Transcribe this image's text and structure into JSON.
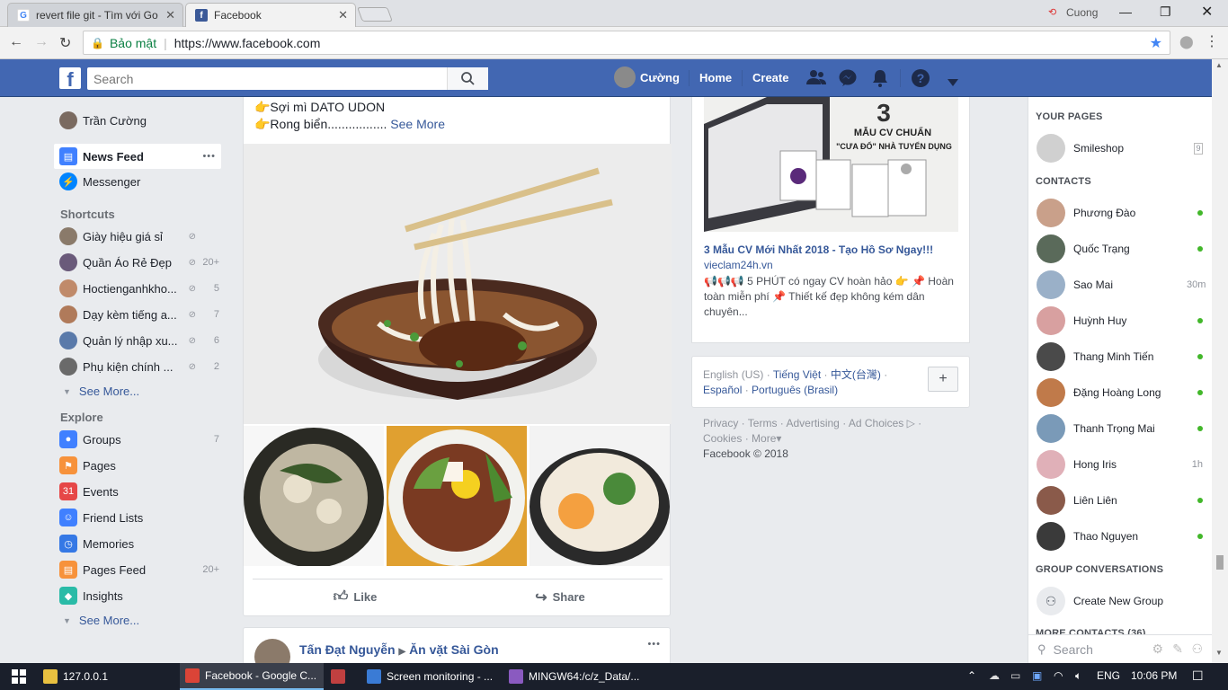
{
  "browser": {
    "tabs": [
      {
        "title": "revert file git - Tìm với Go",
        "icon": "google-icon"
      },
      {
        "title": "Facebook",
        "icon": "facebook-icon"
      }
    ],
    "profile_name": "Cuong",
    "secure_label": "Bảo mật",
    "url": "https://www.facebook.com"
  },
  "fb_header": {
    "search_placeholder": "Search",
    "user_name": "Cường",
    "home": "Home",
    "create": "Create"
  },
  "left_nav": {
    "profile": "Trần Cường",
    "main": [
      {
        "label": "News Feed",
        "icon": "news-feed-icon"
      },
      {
        "label": "Messenger",
        "icon": "messenger-icon"
      }
    ],
    "more_dots": "•••",
    "shortcuts_title": "Shortcuts",
    "shortcuts": [
      {
        "label": "Giày hiệu giá sỉ",
        "count": ""
      },
      {
        "label": "Quần Áo Rẻ Đẹp",
        "count": "20+"
      },
      {
        "label": "Hoctienganhkho...",
        "count": "5"
      },
      {
        "label": "Dạy kèm tiếng a...",
        "count": "7"
      },
      {
        "label": "Quản lý nhập xu...",
        "count": "6"
      },
      {
        "label": "Phụ kiện chính ...",
        "count": "2"
      }
    ],
    "see_more": "See More...",
    "explore_title": "Explore",
    "explore": [
      {
        "label": "Groups",
        "count": "7",
        "icon": "groups-icon",
        "color": "#4080ff"
      },
      {
        "label": "Pages",
        "count": "",
        "icon": "pages-flag-icon",
        "color": "#f7923b"
      },
      {
        "label": "Events",
        "count": "",
        "icon": "events-calendar-icon",
        "color": "#e64747"
      },
      {
        "label": "Friend Lists",
        "count": "",
        "icon": "friend-lists-icon",
        "color": "#4080ff"
      },
      {
        "label": "Memories",
        "count": "",
        "icon": "memories-clock-icon",
        "color": "#3578e5"
      },
      {
        "label": "Pages Feed",
        "count": "20+",
        "icon": "pages-feed-icon",
        "color": "#f7923b"
      },
      {
        "label": "Insights",
        "count": "",
        "icon": "insights-cube-icon",
        "color": "#2abba7"
      }
    ],
    "see_more_2": "See More..."
  },
  "post": {
    "line1": "👉Sợi mì DATO UDON",
    "line2": "👉Rong biển.................",
    "see_more": "See More",
    "like": "Like",
    "share": "Share"
  },
  "post2": {
    "author": "Tấn Đạt Nguyễn",
    "group": "Ăn vặt Sài Gòn",
    "options": "•••"
  },
  "ad": {
    "image_text_1": "3",
    "image_text_2": "MẪU CV CHUẨN",
    "image_text_3": "\"CƯA ĐỔ\" NHÀ TUYỂN DỤNG",
    "title": "3 Mẫu CV Mới Nhất 2018 - Tạo Hồ Sơ Ngay!!!",
    "domain": "vieclam24h.vn",
    "body": "📢📢📢 5 PHÚT có ngay CV hoàn hảo 👉 📌 Hoàn toàn miễn phí 📌 Thiết kế đẹp không kém dân chuyên..."
  },
  "languages": {
    "current": "English (US)",
    "others": [
      "Tiếng Việt",
      "中文(台灣)",
      "Español",
      "Português (Brasil)"
    ],
    "plus": "+"
  },
  "footer": {
    "links": [
      "Privacy",
      "Terms",
      "Advertising",
      "Ad Choices",
      "Cookies",
      "More"
    ],
    "copyright": "Facebook © 2018"
  },
  "chat": {
    "your_pages_title": "YOUR PAGES",
    "page": {
      "name": "Smileshop",
      "badge": "9"
    },
    "contacts_title": "CONTACTS",
    "contacts": [
      {
        "name": "Phương Đào",
        "status": "online",
        "color": "#c9a08a"
      },
      {
        "name": "Quốc Trạng",
        "status": "online",
        "color": "#5a6a5a"
      },
      {
        "name": "Sao Mai",
        "status": "30m",
        "color": "#9ab0c8"
      },
      {
        "name": "Huỳnh Huy",
        "status": "online",
        "color": "#d8a0a0"
      },
      {
        "name": "Thang Minh Tiến",
        "status": "online",
        "color": "#4a4a4a"
      },
      {
        "name": "Đặng Hoàng Long",
        "status": "online",
        "color": "#c07a4a"
      },
      {
        "name": "Thanh Trọng Mai",
        "status": "online",
        "color": "#7a9ab8"
      },
      {
        "name": "Hong Iris",
        "status": "1h",
        "color": "#e0b0b8"
      },
      {
        "name": "Liên Liên",
        "status": "online",
        "color": "#8a5a4a"
      },
      {
        "name": "Thao Nguyen",
        "status": "online",
        "color": "#3a3a3a"
      }
    ],
    "group_title": "GROUP CONVERSATIONS",
    "create_group": "Create New Group",
    "more_contacts": "MORE CONTACTS (36)",
    "search_placeholder": "Search"
  },
  "taskbar": {
    "items": [
      {
        "label": "127.0.0.1",
        "icon": "folder-icon",
        "color": "#e8c040"
      },
      {
        "label": "Facebook - Google C...",
        "icon": "chrome-icon",
        "color": "#db4437"
      },
      {
        "label": "",
        "icon": "snipping-icon",
        "color": "#c04040"
      },
      {
        "label": "Screen monitoring - ...",
        "icon": "app-icon",
        "color": "#3a7bd5"
      },
      {
        "label": "MINGW64:/c/z_Data/...",
        "icon": "git-icon",
        "color": "#8a5ac0"
      }
    ],
    "lang": "ENG",
    "time": "10:06 PM"
  }
}
